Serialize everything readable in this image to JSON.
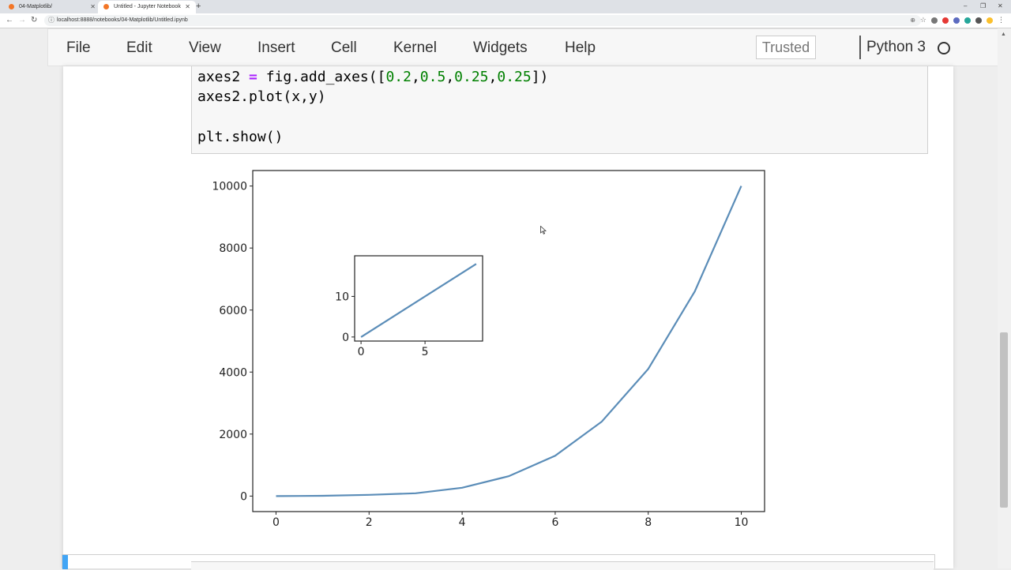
{
  "browser": {
    "tabs": [
      {
        "label": "04-Matplotlib/",
        "active": false
      },
      {
        "label": "Untitled - Jupyter Notebook",
        "active": true
      }
    ],
    "new_tab": "+",
    "url": "localhost:8888/notebooks/04-Matplotlib/Untitled.ipynb",
    "window_controls": {
      "minimize": "–",
      "restore": "❐",
      "close": "✕"
    }
  },
  "menubar": {
    "items": [
      "File",
      "Edit",
      "View",
      "Insert",
      "Cell",
      "Kernel",
      "Widgets",
      "Help"
    ],
    "trusted": "Trusted",
    "kernel": "Python 3"
  },
  "code_cell": {
    "line1": {
      "a": "axes2 ",
      "op": "=",
      "b": " fig.add_axes([",
      "n1": "0.2",
      "c1": ",",
      "n2": "0.5",
      "c2": ",",
      "n3": "0.25",
      "c3": ",",
      "n4": "0.25",
      "end": "])"
    },
    "line2": "axes2.plot(x,y)",
    "line3": "plt.show()"
  },
  "colors": {
    "line": "#5b8db8",
    "accent": "#42a5f5"
  },
  "chart_data": [
    {
      "type": "line",
      "x": [
        0,
        1,
        2,
        3,
        4,
        5,
        6,
        7,
        8,
        9,
        10
      ],
      "y": [
        0,
        10,
        40,
        90,
        270,
        640,
        1300,
        2400,
        4100,
        6600,
        10000
      ],
      "xticks": [
        "0",
        "2",
        "4",
        "6",
        "8",
        "10"
      ],
      "yticks": [
        "0",
        "2000",
        "4000",
        "6000",
        "8000",
        "10000"
      ],
      "xlim": [
        -0.5,
        10.5
      ],
      "ylim": [
        -500,
        10500
      ],
      "title": "",
      "xlabel": "",
      "ylabel": ""
    },
    {
      "type": "line",
      "x": [
        0,
        9
      ],
      "y": [
        0,
        18
      ],
      "xticks": [
        "0",
        "5"
      ],
      "yticks": [
        "0",
        "10"
      ],
      "xlim": [
        -0.5,
        9.5
      ],
      "ylim": [
        -1,
        20
      ],
      "title": "",
      "xlabel": "",
      "ylabel": ""
    }
  ]
}
